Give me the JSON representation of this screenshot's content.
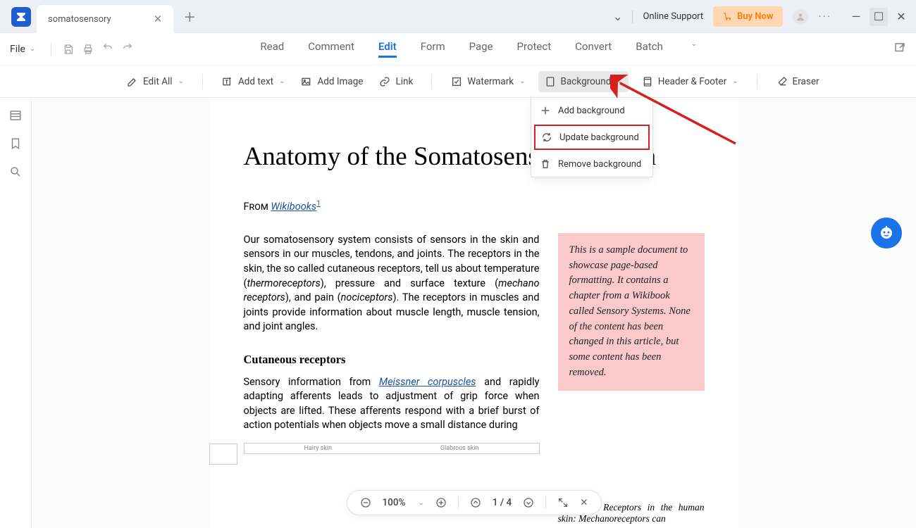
{
  "titlebar": {
    "tab_name": "somatosensory",
    "support": "Online Support",
    "buy": "Buy Now"
  },
  "menu": {
    "file": "File",
    "tabs": [
      "Read",
      "Comment",
      "Edit",
      "Form",
      "Page",
      "Protect",
      "Convert",
      "Batch"
    ],
    "active_tab": "Edit"
  },
  "toolbar": {
    "edit_all": "Edit All",
    "add_text": "Add text",
    "add_image": "Add Image",
    "link": "Link",
    "watermark": "Watermark",
    "background": "Background",
    "header_footer": "Header & Footer",
    "eraser": "Eraser"
  },
  "dropdown": {
    "add": "Add background",
    "update": "Update background",
    "remove": "Remove background"
  },
  "document": {
    "title": "Anatomy of the Somatosensory System",
    "from_label": "From ",
    "wiki": "Wikibooks",
    "sup": "1",
    "p1a": "Our somatosensory system consists of sensors in the skin and sensors in our muscles, tendons, and joints. The receptors in the skin, the so called cutaneous receptors, tell us about temperature (",
    "p1b": "thermoreceptors",
    "p1c": "), pressure and surface texture (",
    "p1d": "mechano receptors",
    "p1e": "), and pain (",
    "p1f": "nociceptors",
    "p1g": "). The receptors in muscles and joints provide information about muscle length, muscle tension, and joint angles.",
    "subhead": "Cutaneous receptors",
    "p2a": "Sensory information from ",
    "p2b": "Meissner corpuscles",
    "p2c": " and rapidly adapting afferents leads to adjustment of grip force when objects are lifted. These afferents respond with a brief burst of action potentials when objects move a small distance during",
    "note": "This is a sample document to showcase page-based formatting. It contains a chapter from a Wikibook called Sensory Systems. None of the content has been changed in this article, but some content has been removed.",
    "fig_caption": "Figure 1: Receptors in the human skin: Mechanoreceptors can",
    "fig_hairy": "Hairy skin",
    "fig_glabrous": "Glabrous skin"
  },
  "status": {
    "zoom": "100%",
    "page": "1 / 4"
  }
}
